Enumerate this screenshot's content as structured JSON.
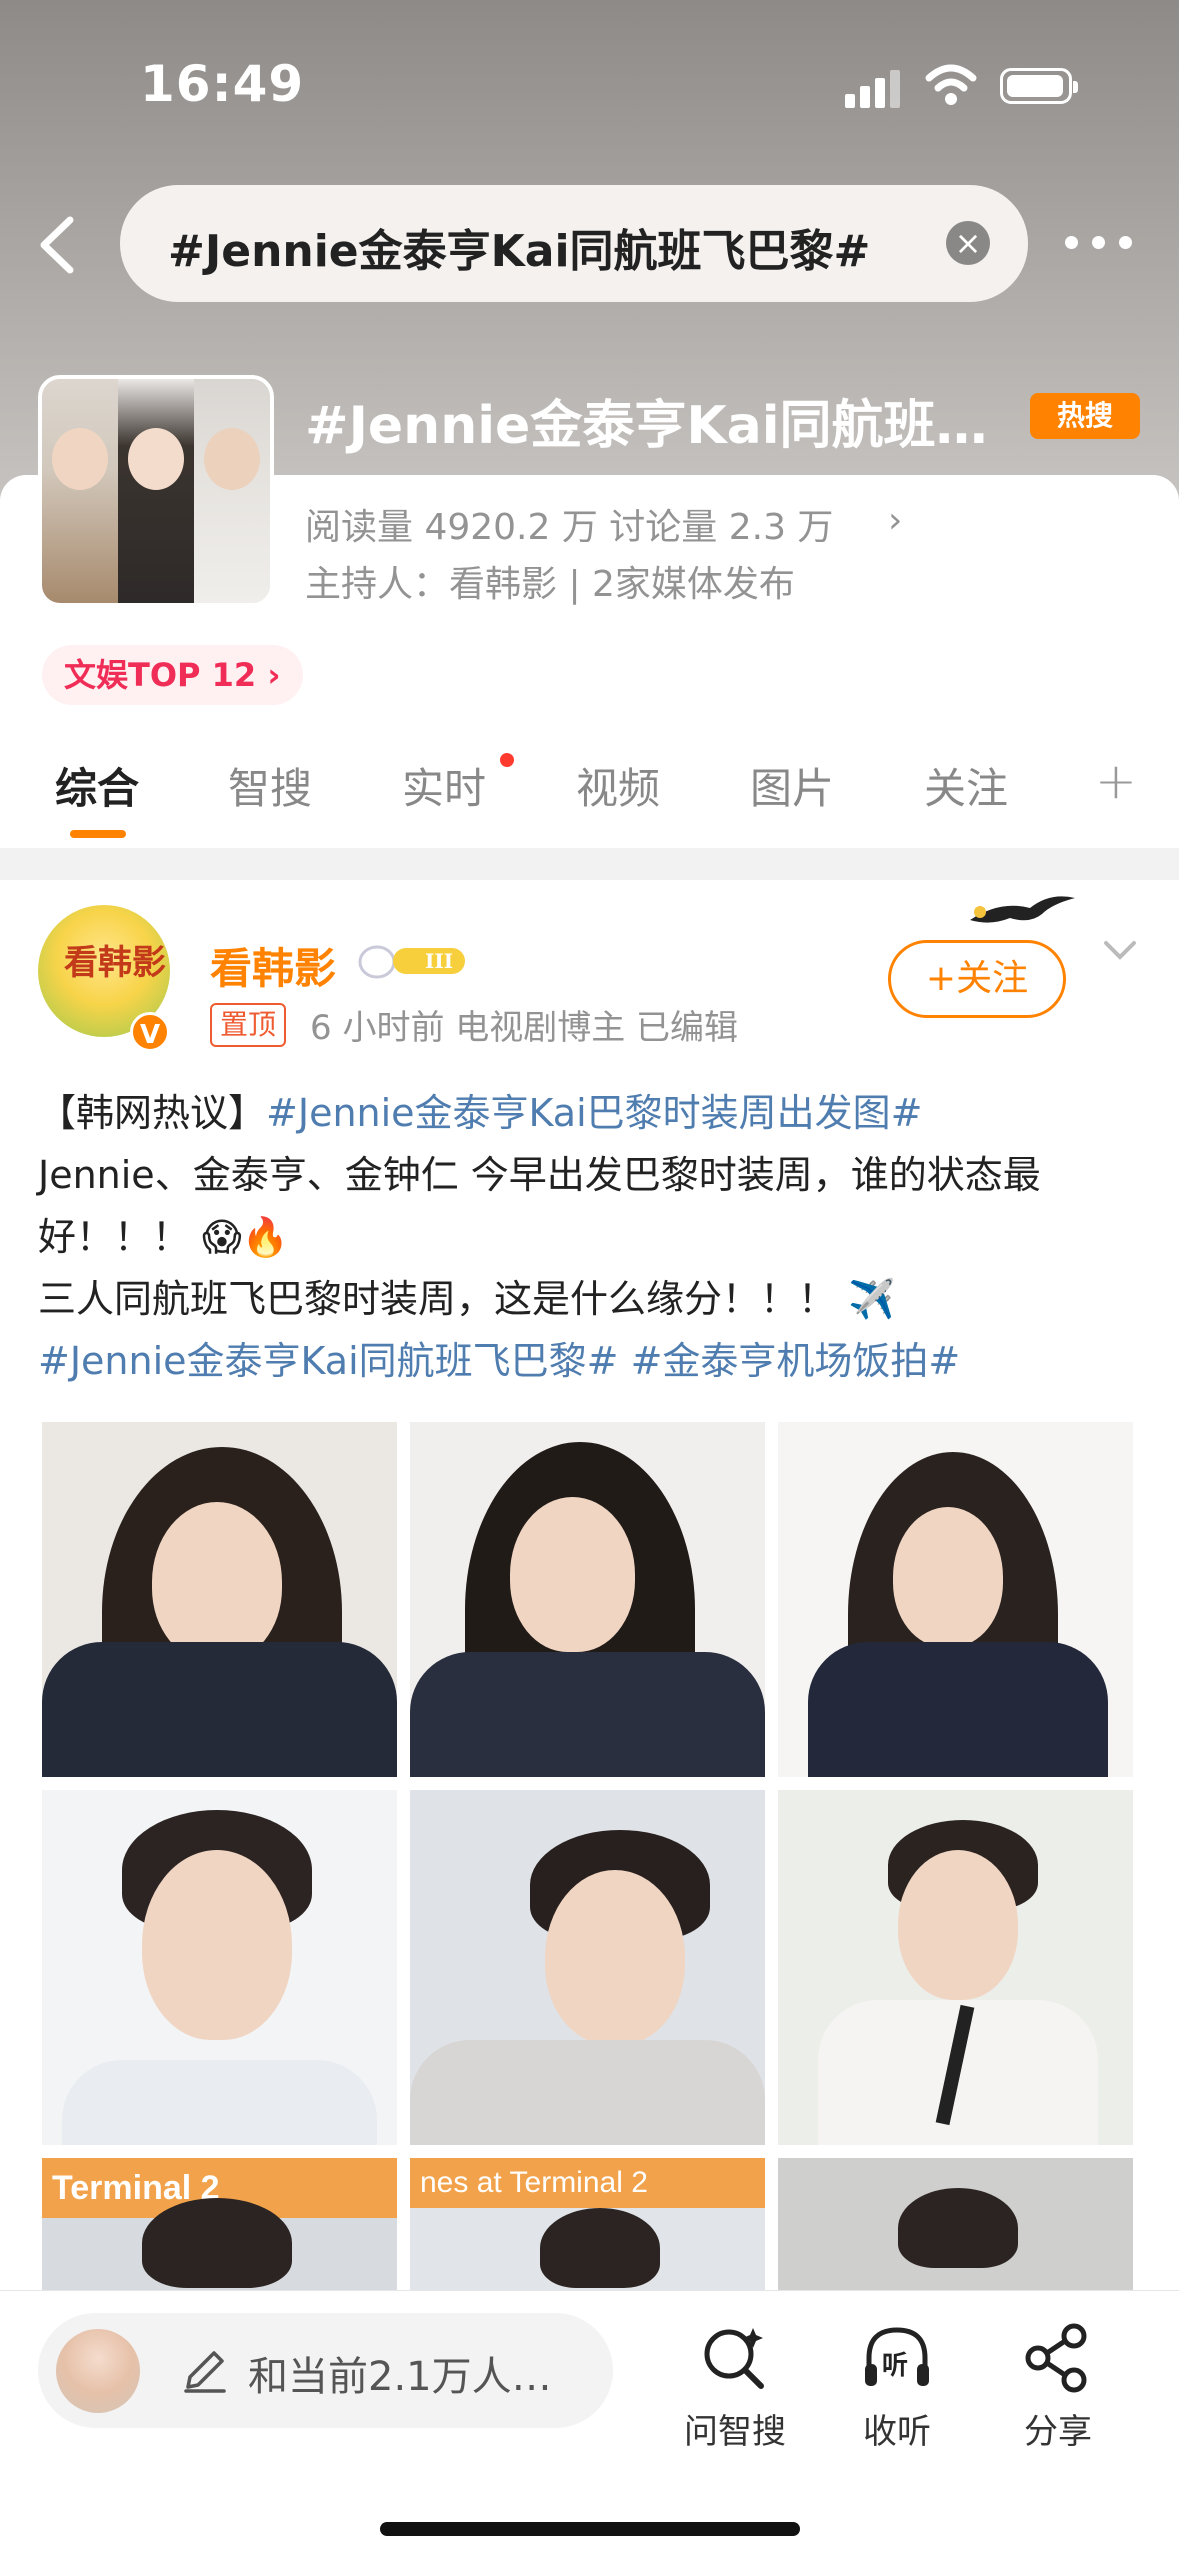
{
  "status_bar": {
    "time": "16:49"
  },
  "search": {
    "query": "#Jennie金泰亨Kai同航班飞巴黎#"
  },
  "topic": {
    "title": "#Jennie金泰亨Kai同航班…",
    "hot_badge": "热搜",
    "stats": "阅读量 4920.2 万  讨论量 2.3 万",
    "host": "主持人：看韩影 | 2家媒体发布",
    "rank_badge": "文娱TOP 12"
  },
  "tabs": [
    {
      "label": "综合",
      "active": true
    },
    {
      "label": "智搜",
      "active": false
    },
    {
      "label": "实时",
      "active": false
    },
    {
      "label": "视频",
      "active": false
    },
    {
      "label": "图片",
      "active": false
    },
    {
      "label": "关注",
      "active": false
    }
  ],
  "post": {
    "avatar_text": "看韩影",
    "username": "看韩影",
    "pinned_label": "置顶",
    "meta": "6 小时前  电视剧博主  已编辑",
    "follow_label": "+关注",
    "line1_prefix": "【韩网热议】",
    "line1_tag": "#Jennie金泰亨Kai巴黎时装周出发图#",
    "line2": "Jennie、金泰亨、金钟仁 今早出发巴黎时装周，谁的状态最好！！！ 😱🔥",
    "line3": "三人同航班飞巴黎时装周，这是什么缘分！！！ ✈️",
    "tag1": "#Jennie金泰亨Kai同航班飞巴黎#",
    "tag2": "#金泰亨机场饭拍#",
    "photo_captions": [
      "Terminal 2",
      "nes at Terminal 2"
    ]
  },
  "bottom_bar": {
    "compose_placeholder": "和当前2.1万人…",
    "actions": [
      {
        "label": "问智搜",
        "icon": "smart-search-icon"
      },
      {
        "label": "收听",
        "icon": "headphones-icon"
      },
      {
        "label": "分享",
        "icon": "share-icon"
      }
    ]
  },
  "colors": {
    "accent": "#ff8200",
    "link": "#507daf",
    "rank": "#ef2d56"
  }
}
